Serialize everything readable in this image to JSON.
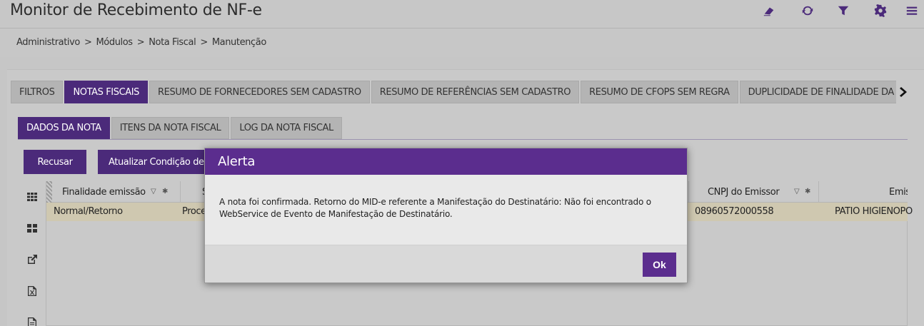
{
  "header": {
    "title": "Monitor de Recebimento de NF-e",
    "icons": [
      "eraser-icon",
      "refresh-icon",
      "filter-icon",
      "gear-icon",
      "menu-icon"
    ]
  },
  "breadcrumb": {
    "items": [
      "Administrativo",
      "Módulos",
      "Nota Fiscal",
      "Manutenção"
    ],
    "separator": ">"
  },
  "main_tabs": [
    {
      "label": "FILTROS",
      "active": false
    },
    {
      "label": "NOTAS FISCAIS",
      "active": true
    },
    {
      "label": "RESUMO DE FORNECEDORES SEM CADASTRO",
      "active": false
    },
    {
      "label": "RESUMO DE REFERÊNCIAS SEM CADASTRO",
      "active": false
    },
    {
      "label": "RESUMO DE CFOPS SEM REGRA",
      "active": false
    },
    {
      "label": "DUPLICIDADE DE FINALIDADE DA OPERAÇÃO",
      "active": false
    }
  ],
  "sub_tabs": [
    {
      "label": "DADOS DA NOTA",
      "active": true
    },
    {
      "label": "ITENS DA NOTA FISCAL",
      "active": false
    },
    {
      "label": "LOG DA NOTA FISCAL",
      "active": false
    }
  ],
  "actions": {
    "recusar": "Recusar",
    "atualizar": "Atualizar Condição de Pagamento"
  },
  "grid": {
    "columns": [
      "Finalidade emissão",
      "S",
      "CNPJ do Emissor",
      "Emis"
    ],
    "row": {
      "finalidade": "Normal/Retorno",
      "status": "Proce",
      "cnpj": "08960572000558",
      "emissor": "PATIO HIGIENOPO"
    }
  },
  "modal": {
    "title": "Alerta",
    "message_line1": "A nota foi confirmada. Retorno do MID-e referente a Manifestação do Destinatário: Não foi encontrado o",
    "message_line2": "WebService de Evento de Manifestação de Destinatário.",
    "ok_label": "Ok"
  },
  "colors": {
    "accent": "#4b2a7a",
    "modal_header": "#5b2d8e",
    "background": "#c6c6c6",
    "selected_row": "#cfc8b0"
  }
}
